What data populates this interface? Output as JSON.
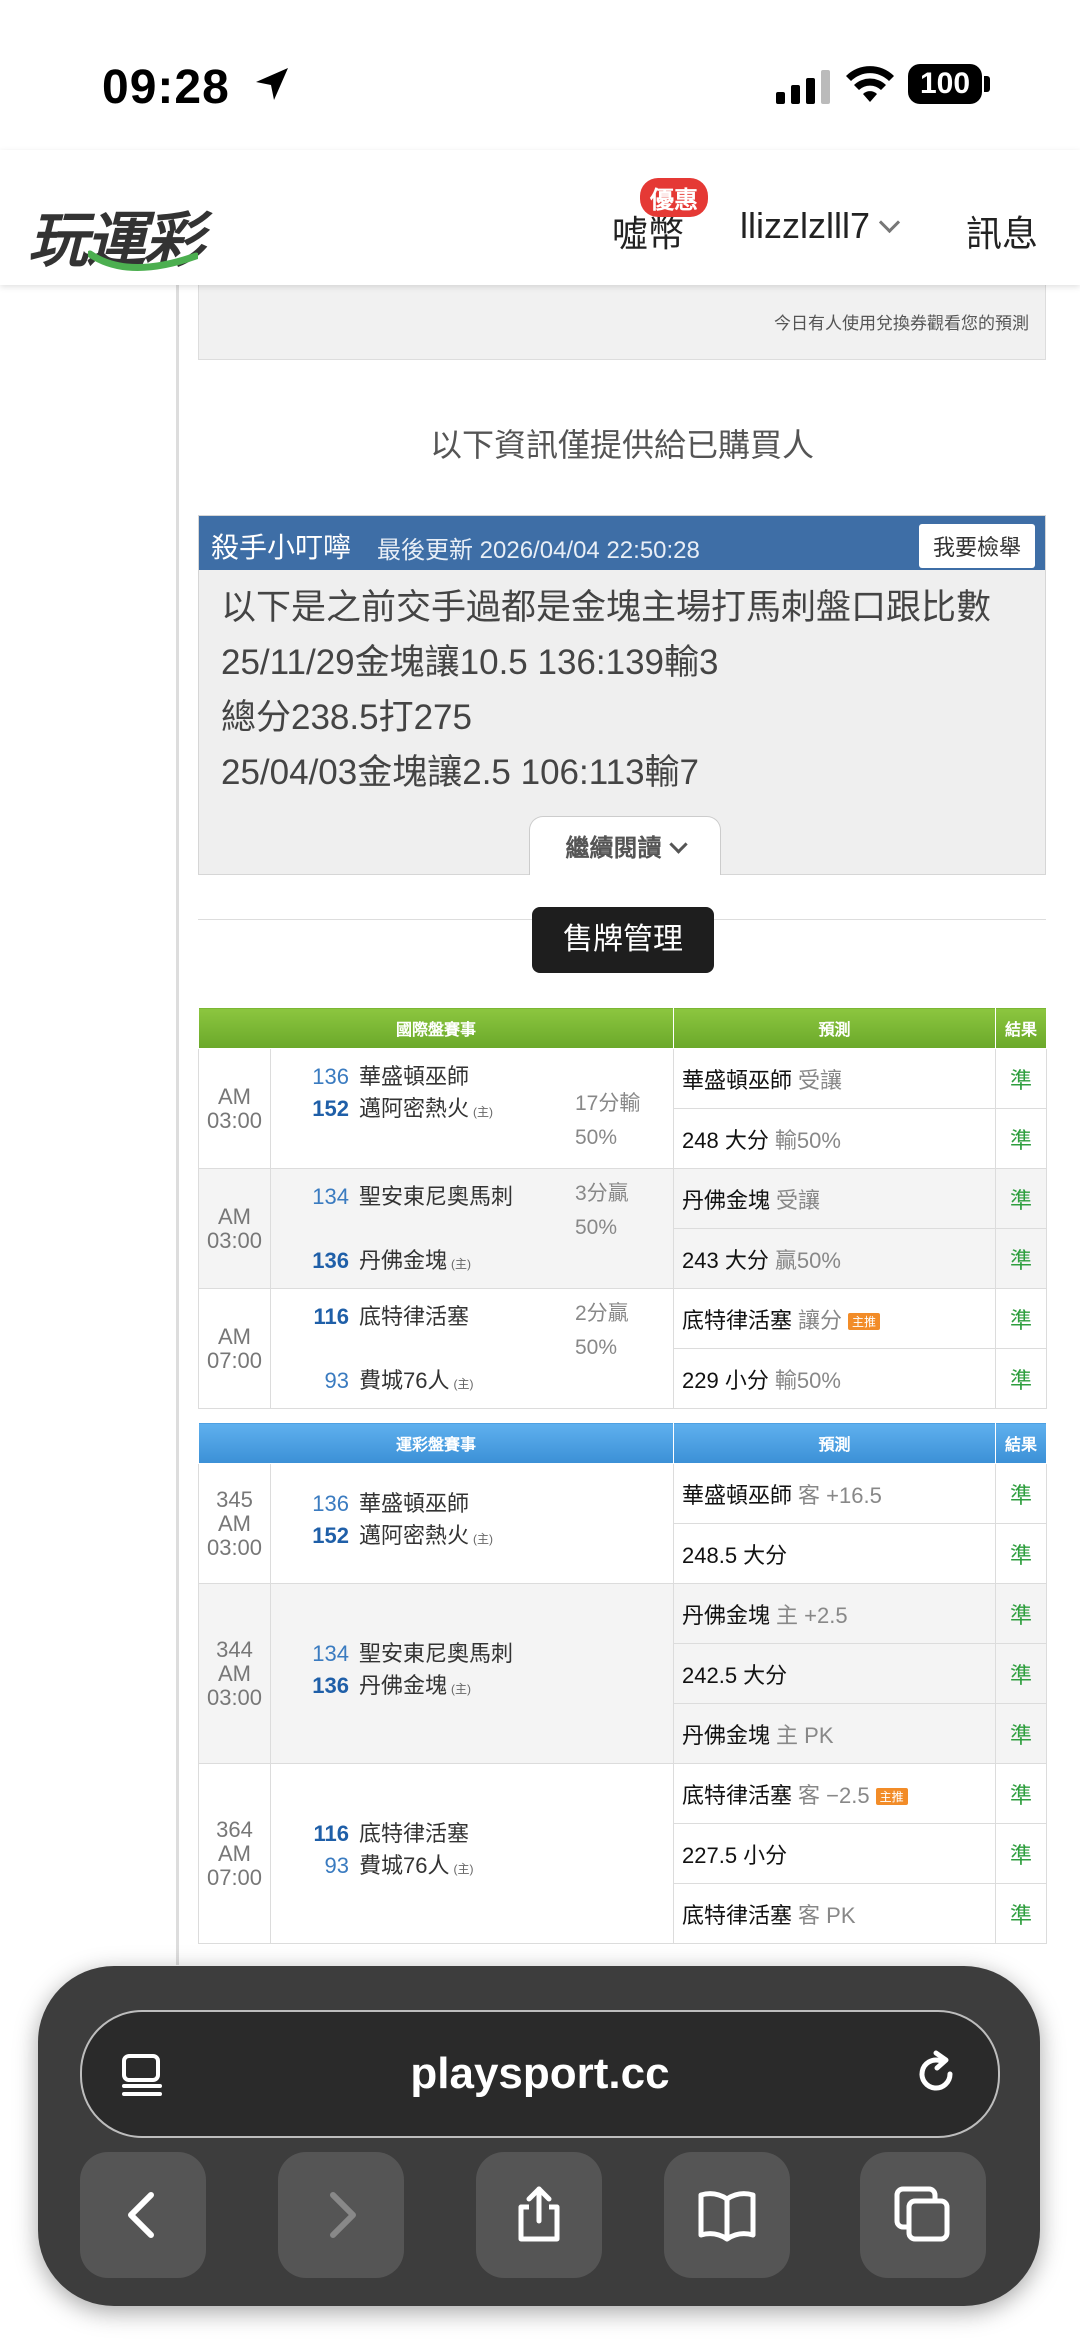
{
  "status": {
    "time": "09:28",
    "battery": "100"
  },
  "header": {
    "logo": "玩運彩",
    "coins": "噓幣",
    "promo_badge": "優惠",
    "username": "llizzlzlll7",
    "messages": "訊息"
  },
  "top_box": {
    "note": "今日有人使用兌換券觀看您的預測"
  },
  "notice": "以下資訊僅提供給已購買人",
  "post": {
    "author": "殺手小叮嚀",
    "updated": "最後更新 2026/04/04 22:50:28",
    "report_label": "我要檢舉",
    "lines": [
      "以下是之前交手過都是金塊主場打馬刺盤口跟比數",
      "25/11/29金塊讓10.5 136:139輸3",
      "總分238.5打275",
      "25/04/03金塊讓2.5 106:113輸7"
    ],
    "read_more": "繼續閱讀"
  },
  "manage_button": "售牌管理",
  "intl_table": {
    "headers": [
      "國際盤賽事",
      "預測",
      "結果"
    ],
    "games": [
      {
        "time": "AM 03:00",
        "away_no": "136",
        "away": "華盛頓巫師",
        "home_no": "152",
        "home": "邁阿密熱火",
        "home_tag": "(主)",
        "side1": "17分輸",
        "side2": "50%",
        "preds": [
          {
            "main": "華盛頓巫師",
            "sub": "受讓",
            "result": "準"
          },
          {
            "main": "248 大分",
            "sub": "輸50%",
            "result": "準"
          }
        ]
      },
      {
        "time": "AM 03:00",
        "away_no": "134",
        "away": "聖安東尼奧馬刺",
        "home_no": "136",
        "home": "丹佛金塊",
        "home_tag": "(主)",
        "side1": "3分贏",
        "side2": "50%",
        "preds": [
          {
            "main": "丹佛金塊",
            "sub": "受讓",
            "result": "準"
          },
          {
            "main": "243 大分",
            "sub": "贏50%",
            "result": "準"
          }
        ]
      },
      {
        "time": "AM 07:00",
        "away_no": "116",
        "away": "底特律活塞",
        "home_no": "93",
        "home": "費城76人",
        "home_tag": "(主)",
        "side1": "2分贏",
        "side2": "50%",
        "preds": [
          {
            "main": "底特律活塞",
            "sub": "讓分",
            "tag": "主推",
            "result": "準"
          },
          {
            "main": "229 小分",
            "sub": "輸50%",
            "result": "準"
          }
        ]
      }
    ]
  },
  "sport_table": {
    "headers": [
      "運彩盤賽事",
      "預測",
      "結果"
    ],
    "games": [
      {
        "code": "345",
        "time": "AM 03:00",
        "away_no": "136",
        "away": "華盛頓巫師",
        "home_no": "152",
        "home": "邁阿密熱火",
        "home_tag": "(主)",
        "preds": [
          {
            "main": "華盛頓巫師",
            "sub": "客 +16.5",
            "result": "準"
          },
          {
            "main": "248.5 大分",
            "sub": "",
            "result": "準"
          }
        ]
      },
      {
        "code": "344",
        "time": "AM 03:00",
        "away_no": "134",
        "away": "聖安東尼奧馬刺",
        "home_no": "136",
        "home": "丹佛金塊",
        "home_tag": "(主)",
        "preds": [
          {
            "main": "丹佛金塊",
            "sub": "主 +2.5",
            "result": "準"
          },
          {
            "main": "242.5 大分",
            "sub": "",
            "result": "準"
          },
          {
            "main": "丹佛金塊",
            "sub": "主 PK",
            "result": "準"
          }
        ]
      },
      {
        "code": "364",
        "time": "AM 07:00",
        "away_no": "116",
        "away": "底特律活塞",
        "home_no": "93",
        "home": "費城76人",
        "home_tag": "(主)",
        "preds": [
          {
            "main": "底特律活塞",
            "sub": "客 −2.5",
            "tag": "主推",
            "result": "準"
          },
          {
            "main": "227.5 小分",
            "sub": "",
            "result": "準"
          },
          {
            "main": "底特律活塞",
            "sub": "客 PK",
            "result": "準"
          }
        ]
      }
    ]
  },
  "browser": {
    "url": "playsport.cc"
  }
}
